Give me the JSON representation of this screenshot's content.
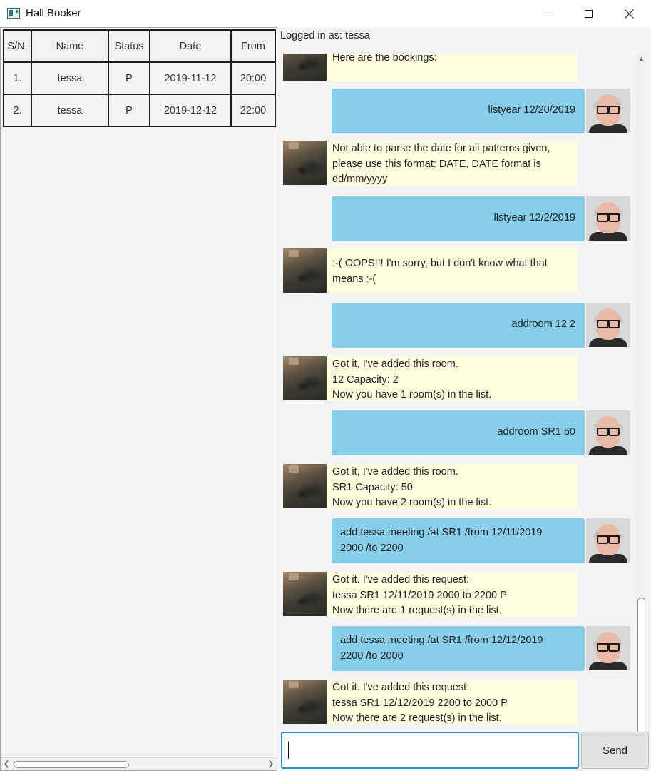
{
  "window": {
    "title": "Hall Booker",
    "icon": "app-window-icon",
    "controls": [
      "minimize-icon",
      "maximize-icon",
      "close-icon"
    ]
  },
  "bookings_table": {
    "headers": [
      "S/N.",
      "Name",
      "Status",
      "Date",
      "From"
    ],
    "rows": [
      [
        "1.",
        "tessa",
        "P",
        "2019-11-12",
        "20:00"
      ],
      [
        "2.",
        "tessa",
        "P",
        "2019-12-12",
        "22:00"
      ]
    ]
  },
  "chat": {
    "login_status": "Logged in as: tessa",
    "messages": [
      {
        "from": "bot",
        "lines": [
          "Here are the bookings:"
        ]
      },
      {
        "from": "user",
        "lines": [
          "listyear 12/20/2019"
        ]
      },
      {
        "from": "bot",
        "lines": [
          "Not able to parse the date for all patterns given,",
          "please use this format: DATE, DATE format is",
          "dd/mm/yyyy"
        ]
      },
      {
        "from": "user",
        "lines": [
          "llstyear 12/2/2019"
        ]
      },
      {
        "from": "bot",
        "lines": [
          ":-( OOPS!!! I'm sorry, but I don't know what that",
          "means :-("
        ]
      },
      {
        "from": "user",
        "lines": [
          "addroom 12 2"
        ]
      },
      {
        "from": "bot",
        "lines": [
          "Got it, I've added this room.",
          "12 Capacity: 2",
          "Now you have 1 room(s) in the list."
        ]
      },
      {
        "from": "user",
        "lines": [
          "addroom SR1 50"
        ]
      },
      {
        "from": "bot",
        "lines": [
          "Got it, I've added this room.",
          "SR1 Capacity: 50",
          "Now you have 2 room(s) in the list."
        ]
      },
      {
        "from": "user",
        "lines": [
          "add tessa meeting /at SR1 /from 12/11/2019",
          "2000 /to 2200"
        ]
      },
      {
        "from": "bot",
        "lines": [
          "Got it. I've added this request:",
          "tessa SR1 12/11/2019 2000 to 2200 P",
          "Now there are 1 request(s) in the list."
        ]
      },
      {
        "from": "user",
        "lines": [
          "add tessa meeting /at SR1 /from 12/12/2019",
          "2200 /to 2000"
        ]
      },
      {
        "from": "bot",
        "lines": [
          "Got it. I've added this request:",
          "tessa SR1 12/12/2019 2200 to 2000 P",
          "Now there are 2 request(s) in the list."
        ]
      }
    ],
    "input_value": "",
    "send_label": "Send"
  }
}
